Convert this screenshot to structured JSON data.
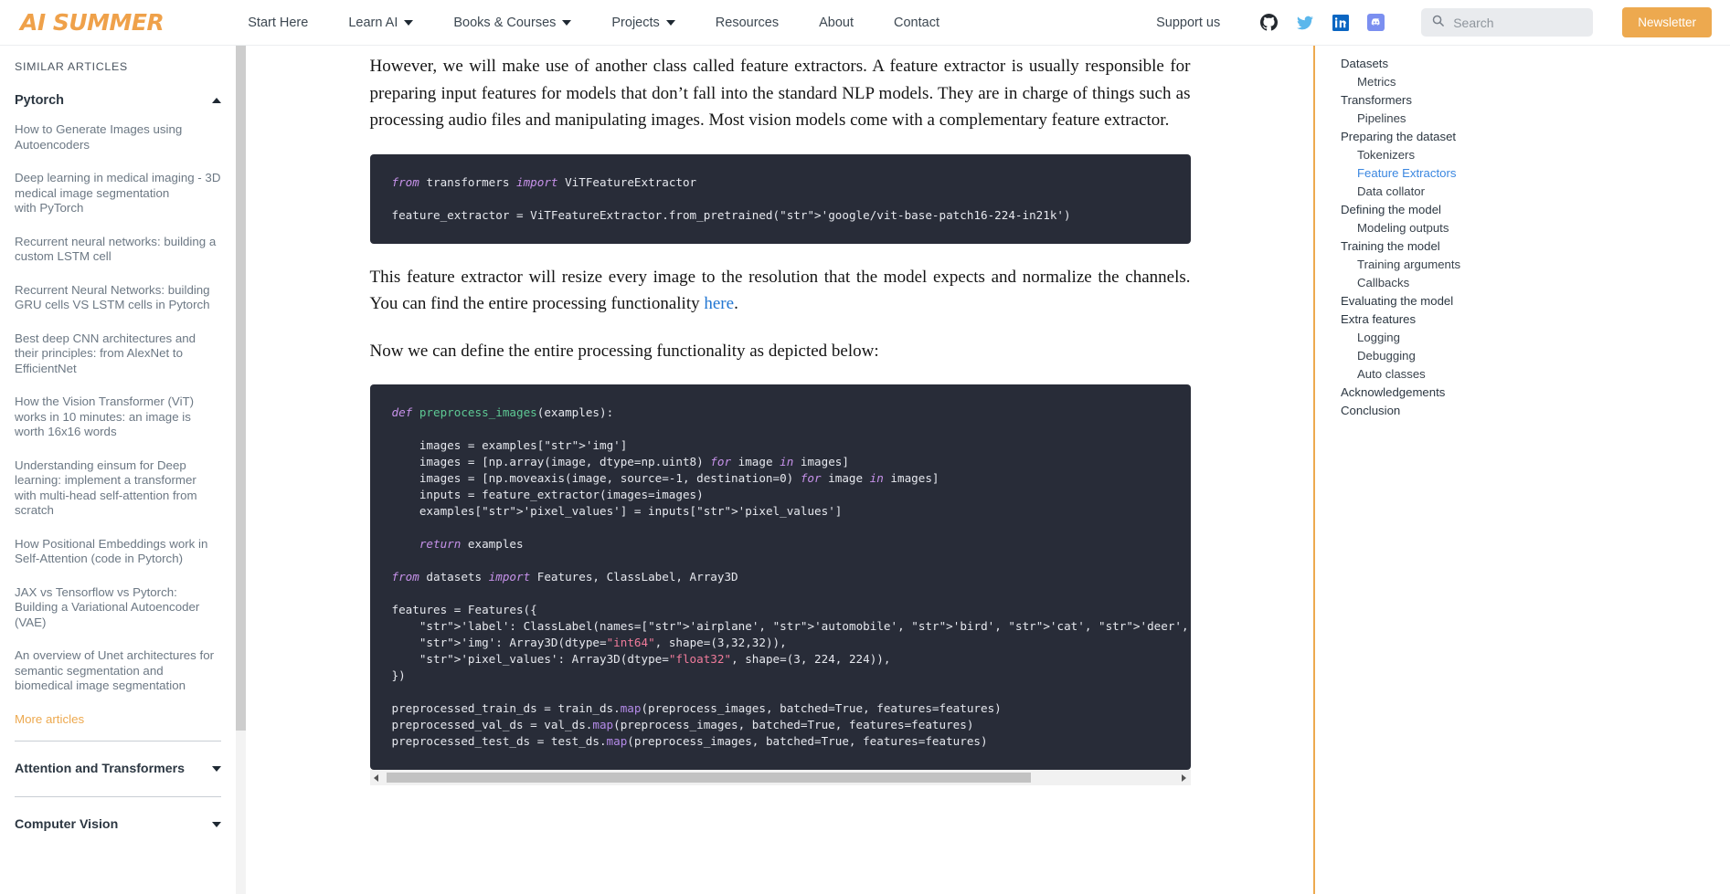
{
  "nav": {
    "logo": "AI SUMMER",
    "links": [
      {
        "label": "Start Here",
        "caret": false
      },
      {
        "label": "Learn AI",
        "caret": true
      },
      {
        "label": "Books & Courses",
        "caret": true
      },
      {
        "label": "Projects",
        "caret": true
      },
      {
        "label": "Resources",
        "caret": false
      },
      {
        "label": "About",
        "caret": false
      },
      {
        "label": "Contact",
        "caret": false
      }
    ],
    "support": "Support us",
    "social": [
      "github-icon",
      "twitter-icon",
      "linkedin-icon",
      "discord-icon"
    ],
    "search_placeholder": "Search",
    "newsletter": "Newsletter",
    "brand_color": "#eda94f"
  },
  "sidebar": {
    "heading": "SIMILAR ARTICLES",
    "section": {
      "title": "Pytorch",
      "expanded": true
    },
    "articles": [
      "How to Generate Images using Autoencoders",
      "Deep learning in medical imaging - 3D medical image segmentation\nwith PyTorch",
      "Recurrent neural networks: building a custom LSTM cell",
      "Recurrent Neural Networks: building GRU cells VS LSTM cells in Pytorch",
      "Best deep CNN architectures and their principles: from AlexNet to EfficientNet",
      "How the Vision Transformer (ViT) works in 10 minutes: an image is worth 16x16 words",
      "Understanding einsum for Deep learning: implement a transformer with multi-head self-attention from scratch",
      "How Positional Embeddings work in Self-Attention (code in Pytorch)",
      "JAX vs Tensorflow vs Pytorch: Building a Variational Autoencoder (VAE)",
      "An overview of Unet architectures for semantic segmentation and biomedical image segmentation"
    ],
    "more_articles": "More articles",
    "collapsed_sections": [
      "Attention and Transformers",
      "Computer Vision"
    ]
  },
  "main": {
    "paragraph_1": "However, we will make use of another class called feature extractors. A feature extractor is usually responsible for preparing input features for models that don’t fall into the standard NLP models. They are in charge of things such as processing audio files and manipulating images. Most vision models come with a complementary feature extractor.",
    "paragraph_2_before": "This feature extractor will resize every image to the resolution that the model expects and normalize the channels. You can find the entire processing functionality ",
    "paragraph_2_link": "here",
    "paragraph_2_after": ".",
    "paragraph_3": "Now we can define the entire processing functionality as depicted below:",
    "code_block_1": "from transformers import ViTFeatureExtractor\n\nfeature_extractor = ViTFeatureExtractor.from_pretrained('google/vit-base-patch16-224-in21k')",
    "code_block_2": "def preprocess_images(examples):\n\n    images = examples['img']\n    images = [np.array(image, dtype=np.uint8) for image in images]\n    images = [np.moveaxis(image, source=-1, destination=0) for image in images]\n    inputs = feature_extractor(images=images)\n    examples['pixel_values'] = inputs['pixel_values']\n\n    return examples\n\nfrom datasets import Features, ClassLabel, Array3D\n\nfeatures = Features({\n    'label': ClassLabel(names=['airplane', 'automobile', 'bird', 'cat', 'deer', 'dog', 'frog', 'horse']),\n    'img': Array3D(dtype=\"int64\", shape=(3,32,32)),\n    'pixel_values': Array3D(dtype=\"float32\", shape=(3, 224, 224)),\n})\n\npreprocessed_train_ds = train_ds.map(preprocess_images, batched=True, features=features)\npreprocessed_val_ds = val_ds.map(preprocess_images, batched=True, features=features)\npreprocessed_test_ds = test_ds.map(preprocess_images, batched=True, features=features)",
    "code_bg": "#282c38"
  },
  "toc": {
    "items": [
      {
        "label": "Datasets",
        "level": 0,
        "active": false
      },
      {
        "label": "Metrics",
        "level": 1,
        "active": false
      },
      {
        "label": "Transformers",
        "level": 0,
        "active": false
      },
      {
        "label": "Pipelines",
        "level": 1,
        "active": false
      },
      {
        "label": "Preparing the dataset",
        "level": 0,
        "active": false
      },
      {
        "label": "Tokenizers",
        "level": 1,
        "active": false
      },
      {
        "label": "Feature Extractors",
        "level": 1,
        "active": true
      },
      {
        "label": "Data collator",
        "level": 1,
        "active": false
      },
      {
        "label": "Defining the model",
        "level": 0,
        "active": false
      },
      {
        "label": "Modeling outputs",
        "level": 1,
        "active": false
      },
      {
        "label": "Training the model",
        "level": 0,
        "active": false
      },
      {
        "label": "Training arguments",
        "level": 1,
        "active": false
      },
      {
        "label": "Callbacks",
        "level": 1,
        "active": false
      },
      {
        "label": "Evaluating the model",
        "level": 0,
        "active": false
      },
      {
        "label": "Extra features",
        "level": 0,
        "active": false
      },
      {
        "label": "Logging",
        "level": 1,
        "active": false
      },
      {
        "label": "Debugging",
        "level": 1,
        "active": false
      },
      {
        "label": "Auto classes",
        "level": 1,
        "active": false
      },
      {
        "label": "Acknowledgements",
        "level": 0,
        "active": false
      },
      {
        "label": "Conclusion",
        "level": 0,
        "active": false
      }
    ],
    "active_color": "#3b87e0"
  }
}
